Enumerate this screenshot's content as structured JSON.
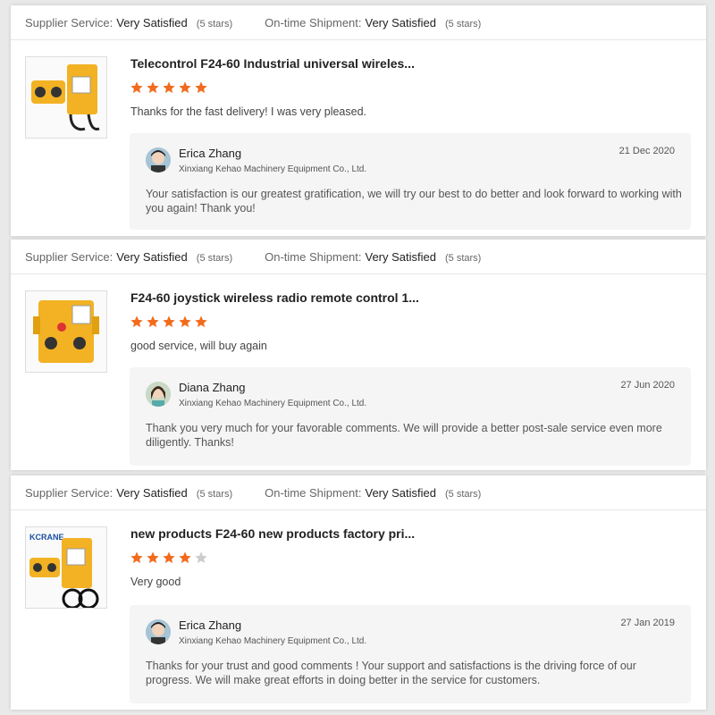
{
  "reviews": [
    {
      "supplier_label": "Supplier Service:",
      "supplier_value": "Very Satisfied",
      "supplier_stars": "(5 stars)",
      "shipment_label": "On-time Shipment:",
      "shipment_value": "Very Satisfied",
      "shipment_stars": "(5 stars)",
      "product_title": "Telecontrol F24-60 Industrial universal wireles...",
      "rating": 5,
      "comment": "Thanks for the fast delivery! I was very pleased.",
      "reply_name": "Erica Zhang",
      "reply_company": "Xinxiang Kehao Machinery Equipment Co., Ltd.",
      "reply_date": "21 Dec 2020",
      "reply_text": "Your satisfaction is our greatest gratification, we will try our best to do better and look forward to working with you again! Thank you!"
    },
    {
      "supplier_label": "Supplier Service:",
      "supplier_value": "Very Satisfied",
      "supplier_stars": "(5 stars)",
      "shipment_label": "On-time Shipment:",
      "shipment_value": "Very Satisfied",
      "shipment_stars": "(5 stars)",
      "product_title": "F24-60 joystick wireless radio remote control 1...",
      "rating": 5,
      "comment": "good service, will buy again",
      "reply_name": "Diana Zhang",
      "reply_company": "Xinxiang Kehao Machinery Equipment Co., Ltd.",
      "reply_date": "27 Jun 2020",
      "reply_text": "Thank you very much for your favorable comments. We will provide a better post-sale service even more diligently. Thanks!"
    },
    {
      "supplier_label": "Supplier Service:",
      "supplier_value": "Very Satisfied",
      "supplier_stars": "(5 stars)",
      "shipment_label": "On-time Shipment:",
      "shipment_value": "Very Satisfied",
      "shipment_stars": "(5 stars)",
      "product_title": "new products F24-60 new products factory pri...",
      "rating": 4,
      "comment": "Very good",
      "reply_name": "Erica Zhang",
      "reply_company": "Xinxiang Kehao Machinery Equipment Co., Ltd.",
      "reply_date": "27 Jan 2019",
      "reply_text": "Thanks for your trust and good comments ! Your support and   satisfactions  is the driving force of our progress. We will make great efforts in doing better in the service for customers."
    }
  ],
  "thumb_logo_text": "KCRANE",
  "colors": {
    "star_on": "#f26b1d",
    "star_off": "#cccccc",
    "product_yellow": "#f2b224"
  }
}
